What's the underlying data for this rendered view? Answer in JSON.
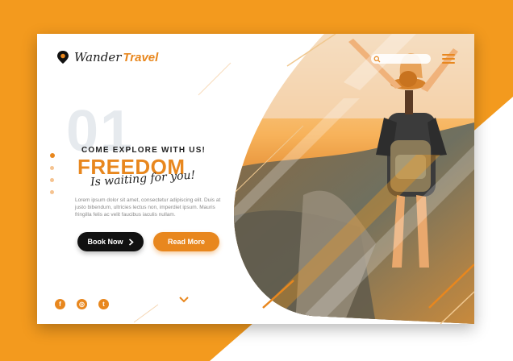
{
  "brand": {
    "name_part1": "Wander",
    "name_part2": "Travel"
  },
  "slide": {
    "number": "01",
    "eyebrow": "COME EXPLORE WITH US!",
    "title": "FREEDOM",
    "script": "Is waiting for you!",
    "paragraph": "Lorem ipsum dolor sit amet, consectetur adipiscing elit. Duis at justo bibendum, ultricies lectus non, imperdiet ipsum. Mauris fringilla felis ac velit faucibus iaculis nullam."
  },
  "buttons": {
    "book": "Book Now",
    "read": "Read More"
  },
  "pagination": {
    "total": 4,
    "active": 1
  },
  "social": [
    "f",
    "◎",
    "t"
  ],
  "icons": {
    "logo": "location-pin-icon",
    "search": "search-icon",
    "menu": "hamburger-menu-icon",
    "scroll": "chevron-down-icon"
  },
  "colors": {
    "accent": "#e8871e",
    "background": "#f39a1e",
    "dark": "#111111"
  }
}
